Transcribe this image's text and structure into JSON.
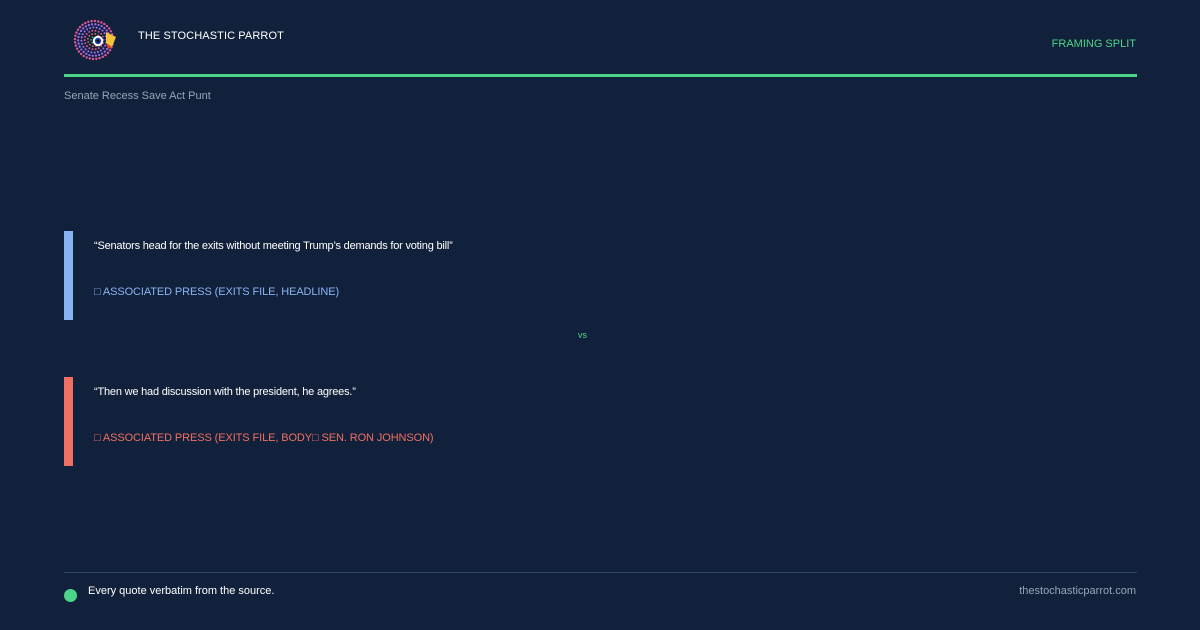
{
  "header": {
    "brand": "THE STOCHASTIC PARROT",
    "section_label": "FRAMING SPLIT",
    "logo_icon": "parrot-logo-icon",
    "accent_color": "#4ad588"
  },
  "topic": "Senate Recess Save Act Punt",
  "quotes": [
    {
      "text": "“Senators head for the exits without meeting Trump’s demands for voting bill”",
      "attribution": "□ ASSOCIATED PRESS (EXITS FILE, HEADLINE)",
      "color": "#89b3f4"
    },
    {
      "text": "“Then we had discussion with the president, he agrees.”",
      "attribution": "□ ASSOCIATED PRESS (EXITS FILE, BODY□ SEN. RON JOHNSON)",
      "color": "#ef6f62"
    }
  ],
  "vs_label": "vs",
  "footer": {
    "note": "Every quote verbatim from the source.",
    "site": "thestochasticparrot.com"
  },
  "colors": {
    "background": "#12213b",
    "muted_text": "#98a3b6"
  }
}
